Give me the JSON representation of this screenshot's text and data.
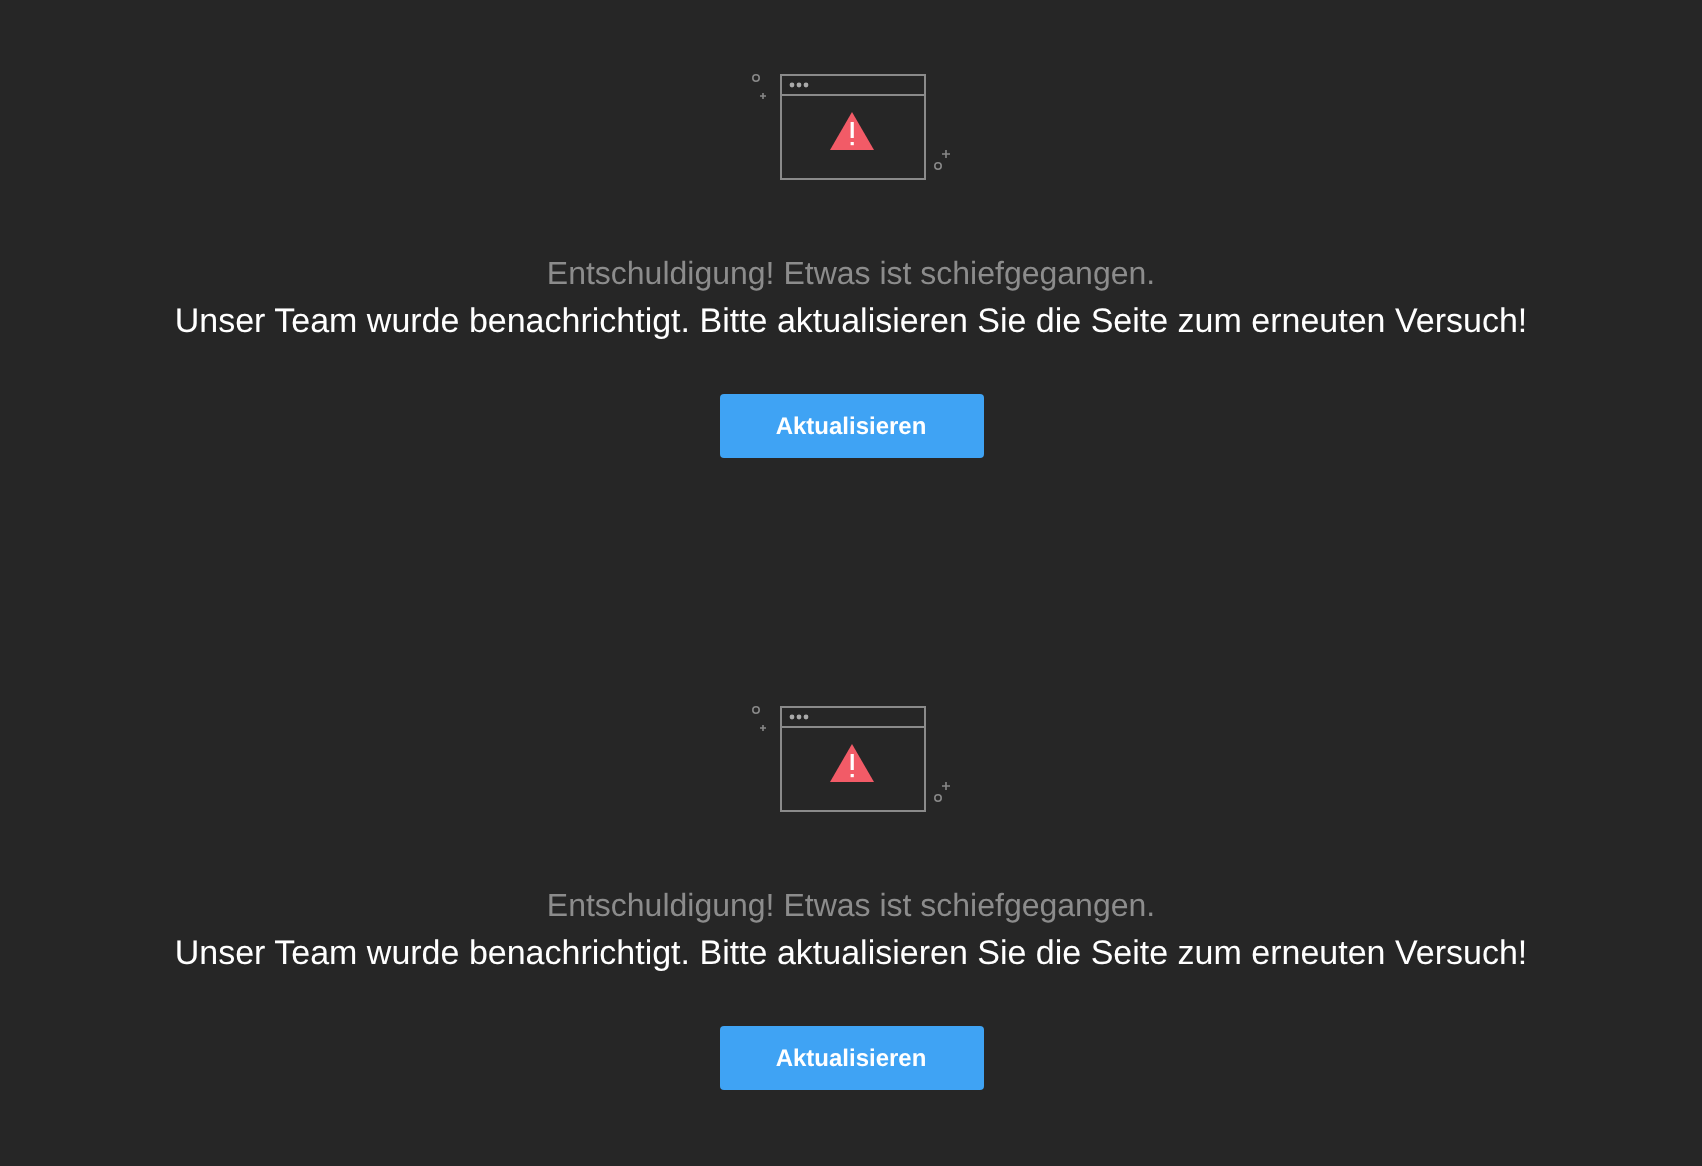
{
  "error_panels": [
    {
      "title": "Entschuldigung! Etwas ist schiefgegangen.",
      "message": "Unser Team wurde benachrichtigt. Bitte aktualisieren Sie die Seite zum erneuten Versuch!",
      "button": "Aktualisieren"
    },
    {
      "title": "Entschuldigung! Etwas ist schiefgegangen.",
      "message": "Unser Team wurde benachrichtigt. Bitte aktualisieren Sie die Seite zum erneuten Versuch!",
      "button": "Aktualisieren"
    }
  ]
}
